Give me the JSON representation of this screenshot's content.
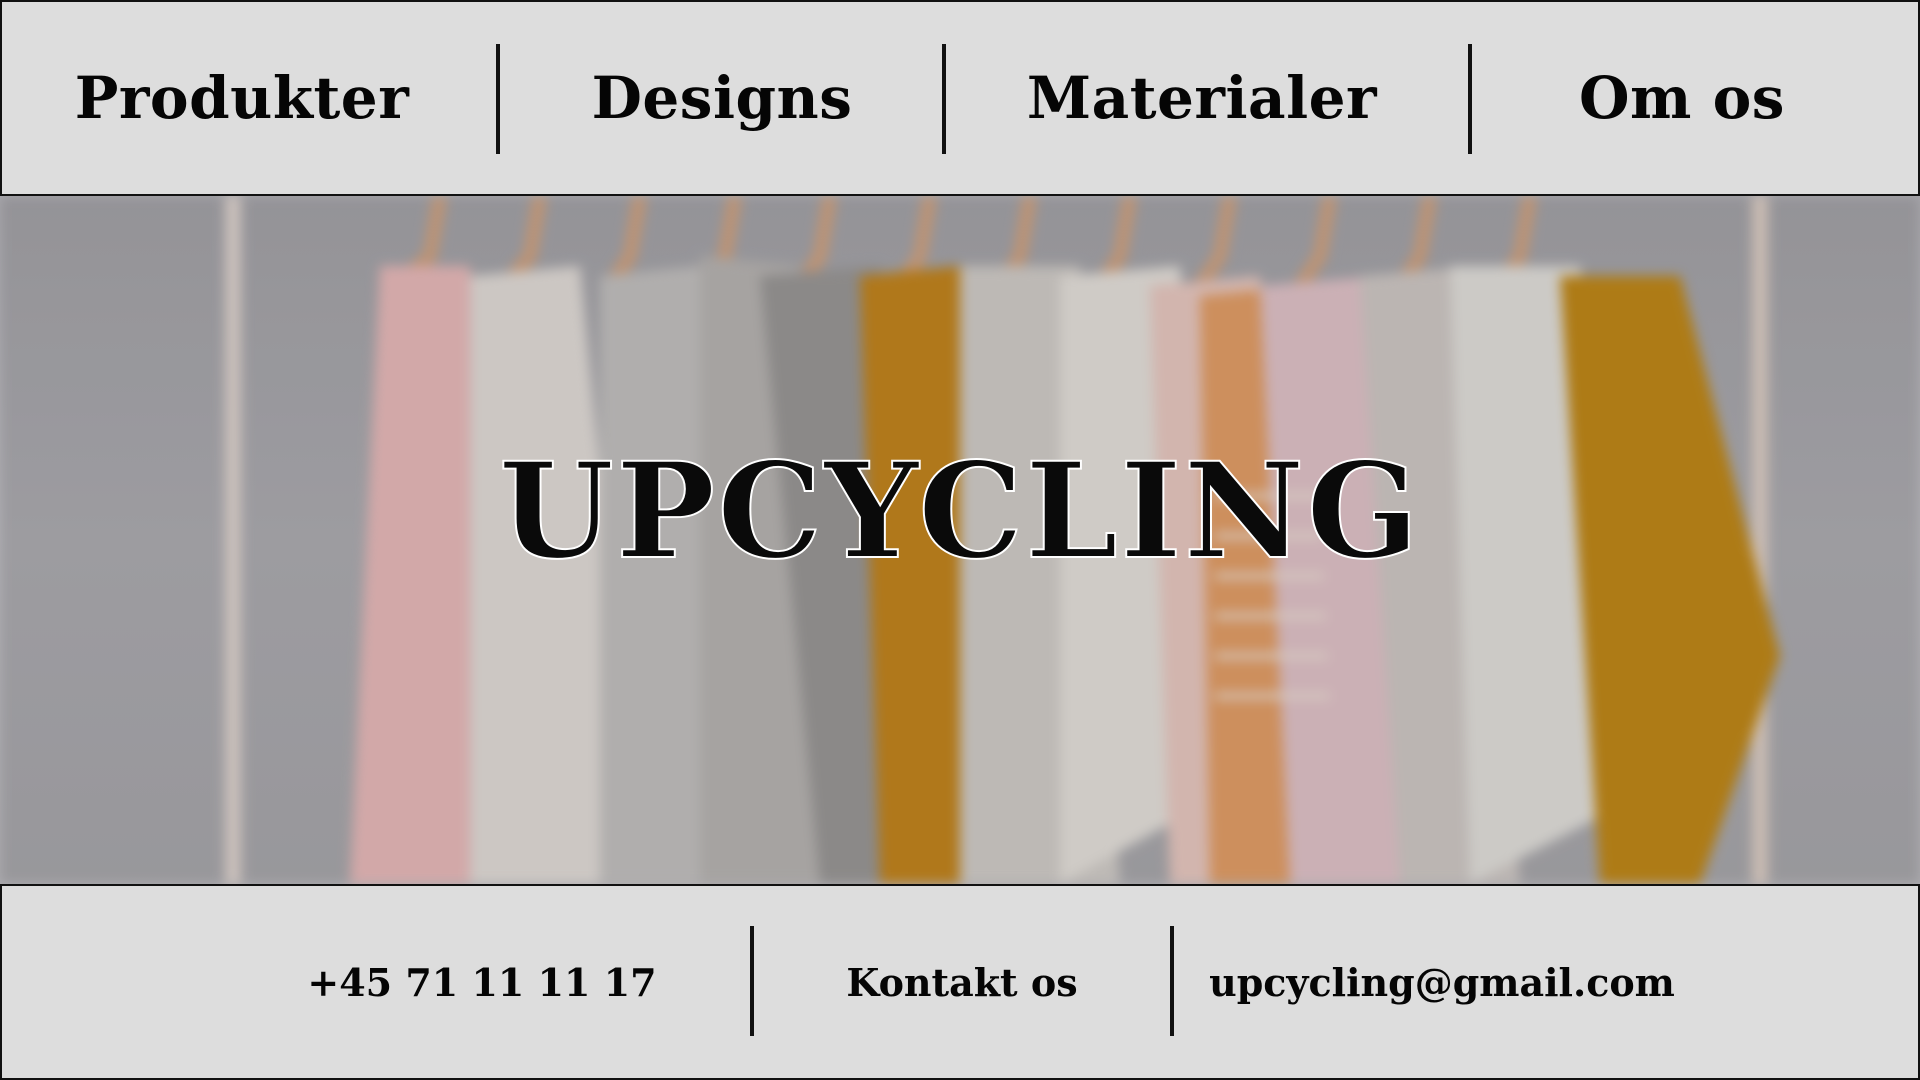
{
  "nav": {
    "items": [
      {
        "label": "Produkter"
      },
      {
        "label": "Designs"
      },
      {
        "label": "Materialer"
      },
      {
        "label": "Om os"
      }
    ]
  },
  "hero": {
    "title": "UPCYCLING",
    "image": "clothes-rack-photo"
  },
  "footer": {
    "phone": "+45 71 11 11 17",
    "contact_label": "Kontakt os",
    "email": "upcycling@gmail.com"
  },
  "colors": {
    "bar_background": "#dddddd",
    "text": "#050505",
    "separator": "#111111"
  }
}
